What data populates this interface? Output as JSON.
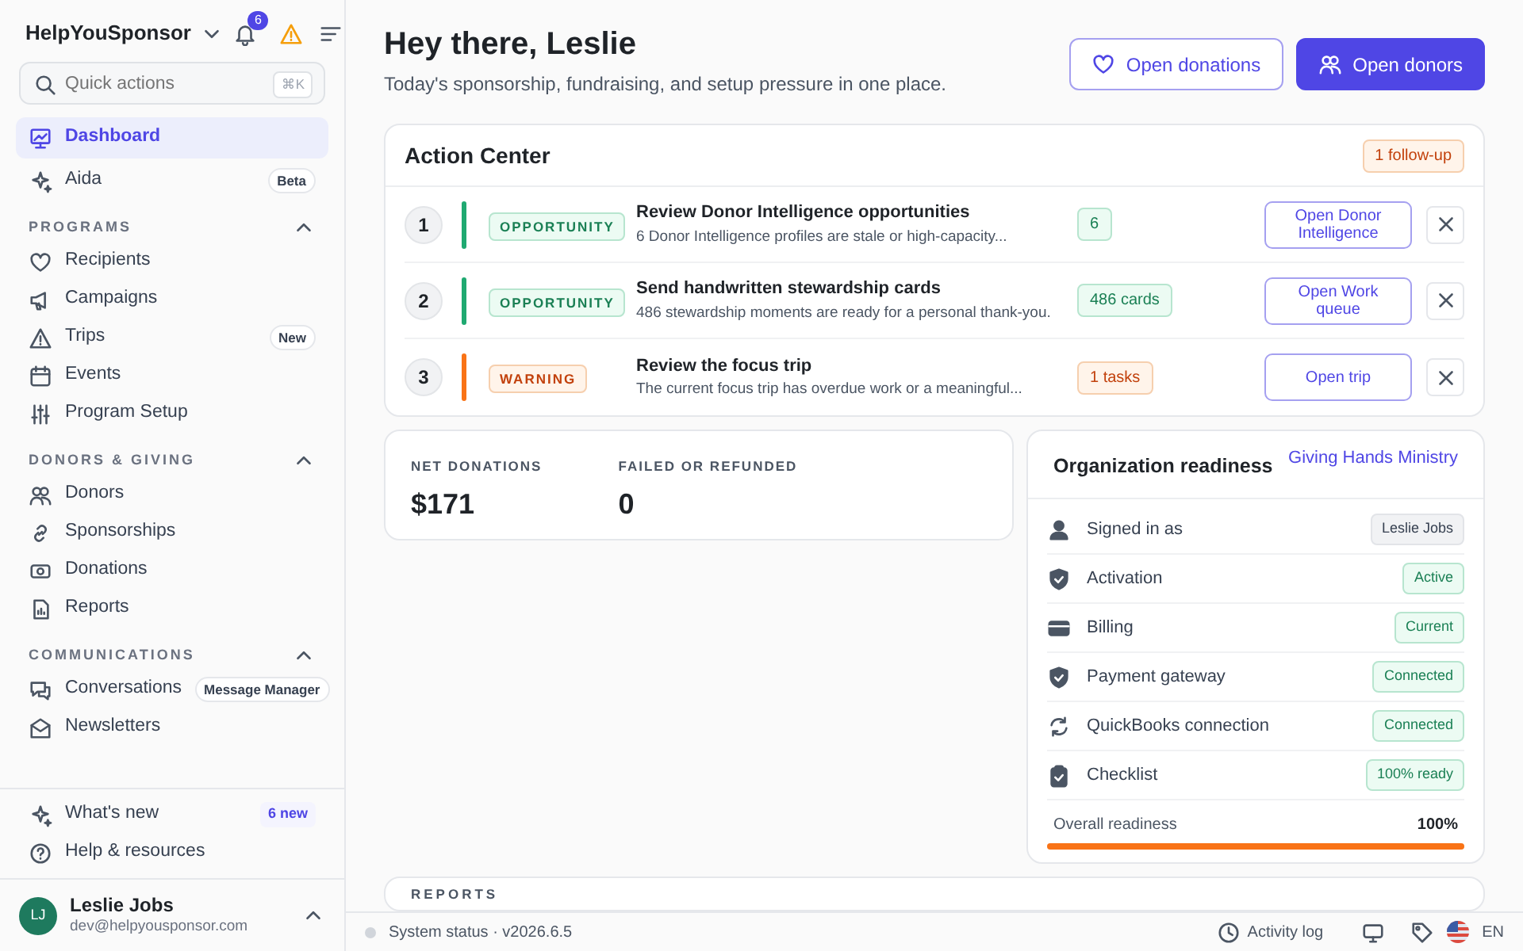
{
  "brand": {
    "name": "HelpYouSponsor",
    "notifications": "6"
  },
  "quick_actions": {
    "placeholder": "Quick actions",
    "shortcut": "⌘K"
  },
  "sidebar": {
    "items": [
      {
        "label": "Dashboard",
        "selected": true
      },
      {
        "label": "Aida",
        "selected": false,
        "badge": "Beta"
      }
    ],
    "sections": [
      {
        "title": "PROGRAMS",
        "expanded": true,
        "items": [
          {
            "label": "Recipients",
            "selected": false
          },
          {
            "label": "Campaigns",
            "selected": false
          },
          {
            "label": "Trips",
            "selected": false,
            "badge": "New"
          },
          {
            "label": "Events",
            "selected": false
          },
          {
            "label": "Program Setup",
            "selected": false
          }
        ]
      },
      {
        "title": "DONORS & GIVING",
        "expanded": true,
        "items": [
          {
            "label": "Donors",
            "selected": false
          },
          {
            "label": "Sponsorships",
            "selected": false
          },
          {
            "label": "Donations",
            "selected": false
          },
          {
            "label": "Reports",
            "selected": false
          }
        ]
      },
      {
        "title": "COMMUNICATIONS",
        "expanded": true,
        "items": [
          {
            "label": "Conversations",
            "selected": false,
            "badge": "Message Manager"
          },
          {
            "label": "Newsletters",
            "selected": false
          }
        ]
      }
    ],
    "footer_items": [
      {
        "label": "What's new",
        "badge": "6 new"
      },
      {
        "label": "Help & resources"
      }
    ],
    "user": {
      "initials": "LJ",
      "name": "Leslie Jobs",
      "email": "dev@helpyousponsor.com"
    }
  },
  "header": {
    "title": "Hey there, Leslie",
    "subtitle": "Today's sponsorship, fundraising, and setup pressure in one place.",
    "buttons": [
      {
        "label": "Open donations",
        "kind": "outline"
      },
      {
        "label": "Open donors",
        "kind": "primary"
      }
    ]
  },
  "action_center": {
    "title": "Action Center",
    "badge": "1 follow-up",
    "items": [
      {
        "number": "1",
        "kind": "opportunity",
        "tag": "OPPORTUNITY",
        "title": "Review Donor Intelligence opportunities",
        "description": "6 Donor Intelligence profiles are stale or high-capacity...",
        "count": "6",
        "action": "Open Donor Intelligence"
      },
      {
        "number": "2",
        "kind": "opportunity",
        "tag": "OPPORTUNITY",
        "title": "Send handwritten stewardship cards",
        "description": "486 stewardship moments are ready for a personal thank-you.",
        "count": "486 cards",
        "action": "Open Work queue"
      },
      {
        "number": "3",
        "kind": "warning",
        "tag": "WARNING",
        "title": "Review the focus trip",
        "description": "The current focus trip has overdue work or a meaningful...",
        "count": "1 tasks",
        "action": "Open trip"
      }
    ]
  },
  "stats": [
    {
      "label": "NET DONATIONS",
      "value": "$171"
    },
    {
      "label": "FAILED OR REFUNDED",
      "value": "0"
    }
  ],
  "readiness": {
    "title": "Organization readiness",
    "org": "Giving Hands Ministry",
    "rows": [
      {
        "label": "Signed in as",
        "value": "Leslie Jobs",
        "kind": "neutral"
      },
      {
        "label": "Activation",
        "value": "Active",
        "kind": "success"
      },
      {
        "label": "Billing",
        "value": "Current",
        "kind": "success"
      },
      {
        "label": "Payment gateway",
        "value": "Connected",
        "kind": "success"
      },
      {
        "label": "QuickBooks connection",
        "value": "Connected",
        "kind": "success"
      },
      {
        "label": "Checklist",
        "value": "100% ready",
        "kind": "success"
      }
    ],
    "overall_label": "Overall readiness",
    "overall_value": "100%",
    "level": 1
  },
  "reports": {
    "title": "REPORTS"
  },
  "status_bar": {
    "status": "System status · v2026.6.5",
    "activity": "Activity log",
    "language": "EN"
  }
}
